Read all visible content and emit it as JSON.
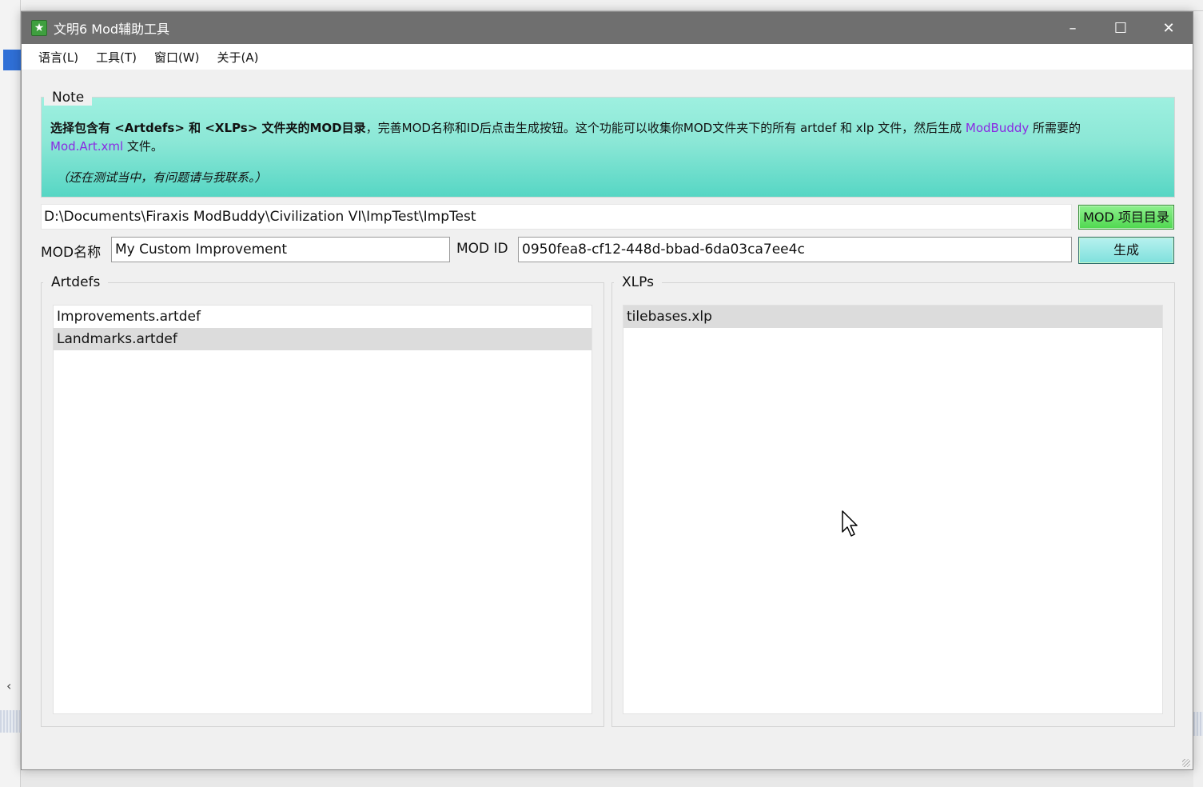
{
  "window": {
    "title": "文明6 Mod辅助工具",
    "icon": "app-icon",
    "controls": {
      "minimize": "–",
      "maximize": "☐",
      "close": "✕"
    }
  },
  "menu": {
    "items": [
      {
        "label": "语言(L)"
      },
      {
        "label": "工具(T)"
      },
      {
        "label": "窗口(W)"
      },
      {
        "label": "关于(A)"
      }
    ]
  },
  "note": {
    "title": "Note",
    "line_bold": "选择包含有 <Artdefs> 和 <XLPs> 文件夹的MOD目录",
    "line_rest": "，完善MOD名称和ID后点击生成按钮。这个功能可以收集你MOD文件夹下的所有 artdef 和 xlp 文件，然后生成",
    "link1": "ModBuddy",
    "after_link1": " 所需要的",
    "link2": "Mod.Art.xml",
    "after_link2": " 文件。",
    "subnote": "（还在测试当中，有问题请与我联系。）"
  },
  "path": {
    "value": "D:\\Documents\\Firaxis ModBuddy\\Civilization VI\\ImpTest\\ImpTest",
    "button": "MOD 项目目录"
  },
  "mod": {
    "name_label": "MOD名称",
    "name_value": "My Custom Improvement",
    "id_label": "MOD ID",
    "id_value": "0950fea8-cf12-448d-bbad-6da03ca7ee4c",
    "generate_button": "生成"
  },
  "artdefs": {
    "title": "Artdefs",
    "items": [
      "Improvements.artdef",
      "Landmarks.artdef"
    ],
    "selected_index": 1
  },
  "xlps": {
    "title": "XLPs",
    "items": [
      "tilebases.xlp"
    ],
    "selected_index": 0
  }
}
